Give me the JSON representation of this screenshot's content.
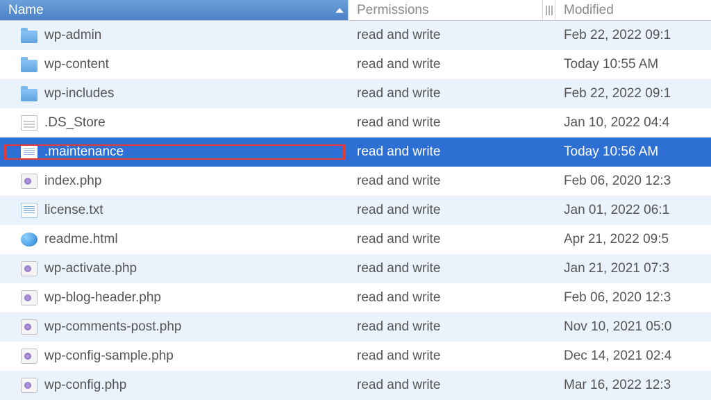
{
  "columns": {
    "name": "Name",
    "permissions": "Permissions",
    "modified": "Modified"
  },
  "rows": [
    {
      "icon": "folder",
      "name": "wp-admin",
      "perm": "read and write",
      "mod": "Feb 22, 2022 09:1",
      "zebra": "odd"
    },
    {
      "icon": "folder",
      "name": "wp-content",
      "perm": "read and write",
      "mod": "Today 10:55 AM",
      "zebra": "even"
    },
    {
      "icon": "folder",
      "name": "wp-includes",
      "perm": "read and write",
      "mod": "Feb 22, 2022 09:1",
      "zebra": "odd"
    },
    {
      "icon": "file",
      "name": ".DS_Store",
      "perm": "read and write",
      "mod": "Jan 10, 2022 04:4",
      "zebra": "even"
    },
    {
      "icon": "txt",
      "name": ".maintenance",
      "perm": "read and write",
      "mod": "Today 10:56 AM",
      "zebra": "odd",
      "selected": true,
      "highlighted": true
    },
    {
      "icon": "php",
      "name": "index.php",
      "perm": "read and write",
      "mod": "Feb 06, 2020 12:3",
      "zebra": "even"
    },
    {
      "icon": "txt",
      "name": "license.txt",
      "perm": "read and write",
      "mod": "Jan 01, 2022 06:1",
      "zebra": "odd"
    },
    {
      "icon": "html",
      "name": "readme.html",
      "perm": "read and write",
      "mod": "Apr 21, 2022 09:5",
      "zebra": "even"
    },
    {
      "icon": "php",
      "name": "wp-activate.php",
      "perm": "read and write",
      "mod": "Jan 21, 2021 07:3",
      "zebra": "odd"
    },
    {
      "icon": "php",
      "name": "wp-blog-header.php",
      "perm": "read and write",
      "mod": "Feb 06, 2020 12:3",
      "zebra": "even"
    },
    {
      "icon": "php",
      "name": "wp-comments-post.php",
      "perm": "read and write",
      "mod": "Nov 10, 2021 05:0",
      "zebra": "odd"
    },
    {
      "icon": "php",
      "name": "wp-config-sample.php",
      "perm": "read and write",
      "mod": "Dec 14, 2021 02:4",
      "zebra": "even"
    },
    {
      "icon": "php",
      "name": "wp-config.php",
      "perm": "read and write",
      "mod": "Mar 16, 2022 12:3",
      "zebra": "odd"
    }
  ]
}
